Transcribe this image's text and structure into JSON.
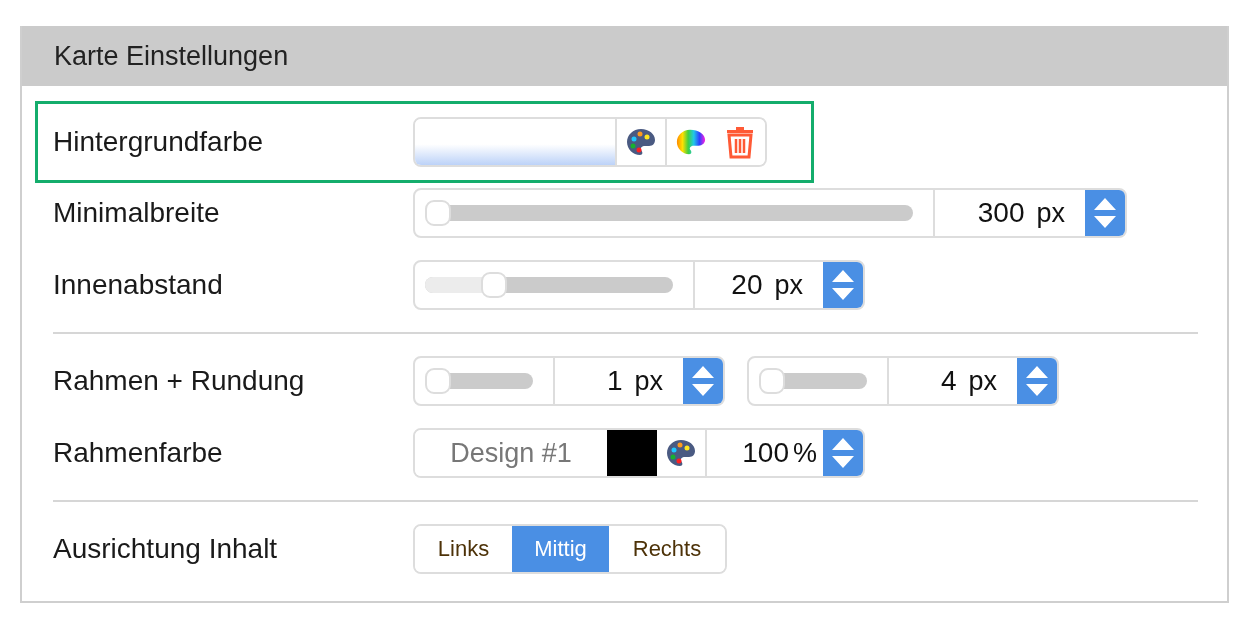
{
  "panel_title": "Karte Einstellungen",
  "rows": [
    {
      "kind": "color",
      "label": "Hintergrundfarbe",
      "highlighted": true,
      "divider_before": false
    },
    {
      "kind": "sliders",
      "label": "Minimalbreite",
      "highlighted": false,
      "divider_before": false,
      "controls": [
        {
          "level": 0,
          "value": "300",
          "unit": "px"
        }
      ]
    },
    {
      "kind": "sliders",
      "label": "Innenabstand",
      "highlighted": false,
      "divider_before": false,
      "controls": [
        {
          "level": 0.25,
          "value": "20",
          "unit": "px"
        }
      ]
    },
    {
      "kind": "sliders",
      "label": "Rahmen + Rundung",
      "highlighted": false,
      "divider_before": true,
      "controls": [
        {
          "level": 0,
          "value": "1",
          "unit": "px"
        },
        {
          "level": 0,
          "value": "4",
          "unit": "px"
        }
      ]
    },
    {
      "kind": "border-color",
      "label": "Rahmenfarbe",
      "highlighted": false,
      "divider_before": false,
      "placeholder": "Design #1",
      "color": "#000000",
      "value": "100",
      "unit": "%"
    },
    {
      "kind": "segmented",
      "label": "Ausrichtung Inhalt",
      "highlighted": false,
      "divider_before": true,
      "options": [
        {
          "label": "Links",
          "selected": false
        },
        {
          "label": "Mittig",
          "selected": true
        },
        {
          "label": "Rechts",
          "selected": false
        }
      ]
    }
  ]
}
